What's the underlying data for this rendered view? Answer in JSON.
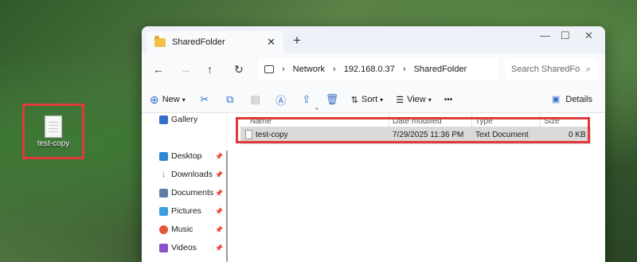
{
  "desktop": {
    "file_label": "test-copy"
  },
  "window": {
    "tab_title": "SharedFolder",
    "breadcrumb": [
      "Network",
      "192.168.0.37",
      "SharedFolder"
    ],
    "search_placeholder": "Search SharedFo"
  },
  "toolbar": {
    "new_label": "New",
    "sort_label": "Sort",
    "view_label": "View",
    "details_label": "Details",
    "more": "•••"
  },
  "sidebar": {
    "items": [
      {
        "label": "Gallery"
      },
      {
        "label": "Desktop"
      },
      {
        "label": "Downloads"
      },
      {
        "label": "Documents"
      },
      {
        "label": "Pictures"
      },
      {
        "label": "Music"
      },
      {
        "label": "Videos"
      }
    ]
  },
  "columns": {
    "name": "Name",
    "date": "Date modified",
    "type": "Type",
    "size": "Size"
  },
  "files": [
    {
      "name": "test-copy",
      "date": "7/29/2025 11:36 PM",
      "type": "Text Document",
      "size": "0 KB"
    }
  ],
  "colors": {
    "highlight": "#e03a3a",
    "accent": "#3470c9"
  }
}
